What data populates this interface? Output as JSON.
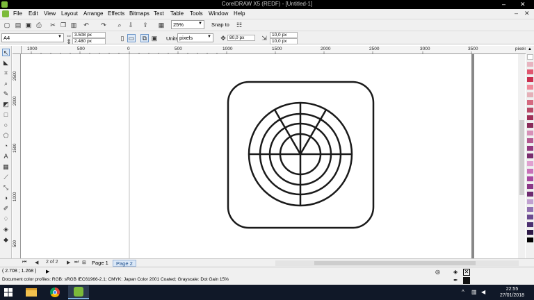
{
  "window": {
    "title": "CorelDRAW X5 (REDF) - [Untitled-1]",
    "minimize": "–",
    "close": "✕"
  },
  "menu": {
    "items": [
      "File",
      "Edit",
      "View",
      "Layout",
      "Arrange",
      "Effects",
      "Bitmaps",
      "Text",
      "Table",
      "Tools",
      "Window",
      "Help"
    ],
    "controls": [
      "–",
      "✕"
    ]
  },
  "standard_toolbar": {
    "zoom_value": "25%",
    "snap_to": "Snap to"
  },
  "property_bar": {
    "page_size": "A4",
    "width": "3.508 px",
    "height": "2.480 px",
    "units_label": "Units:",
    "units_value": "pixels",
    "nudge": "80,0 px",
    "dup_x": "10,0 px",
    "dup_y": "10,0 px"
  },
  "ruler": {
    "h_labels": [
      "1000",
      "500",
      "0",
      "500",
      "1000",
      "1500",
      "2000",
      "2500",
      "3000",
      "3500",
      "pixels"
    ],
    "v_labels": [
      "2500",
      "2000",
      "1500",
      "1000",
      "500",
      "0"
    ]
  },
  "page_nav": {
    "counter": "2 of 2",
    "tabs": [
      "Page 1",
      "Page 2"
    ],
    "active_tab": "Page 2"
  },
  "status": {
    "coords": "( 2.708 ; 1.268 )",
    "profile": "Document color profiles: RGB: sRGB IEC61966-2.1; CMYK: Japan Color 2001 Coated; Grayscale: Dot Gain 15%"
  },
  "palette": {
    "colors": [
      "#ffffff",
      "#e8b4c0",
      "#e0566f",
      "#c92f4f",
      "#f08a9a",
      "#e5b0b8",
      "#d56a80",
      "#b84a68",
      "#a03058",
      "#8a2c5a",
      "#d790b8",
      "#b35890",
      "#943880",
      "#7a2c6e",
      "#e0a0d0",
      "#c870b8",
      "#a848a0",
      "#8c3888",
      "#6e2a70",
      "#c0a0d0",
      "#9070b0",
      "#6a4a90",
      "#4c3070",
      "#2e1a48",
      "#000000"
    ]
  },
  "taskbar": {
    "time": "22:55",
    "date": "27/01/2018"
  },
  "accent": "#1e4e8c"
}
